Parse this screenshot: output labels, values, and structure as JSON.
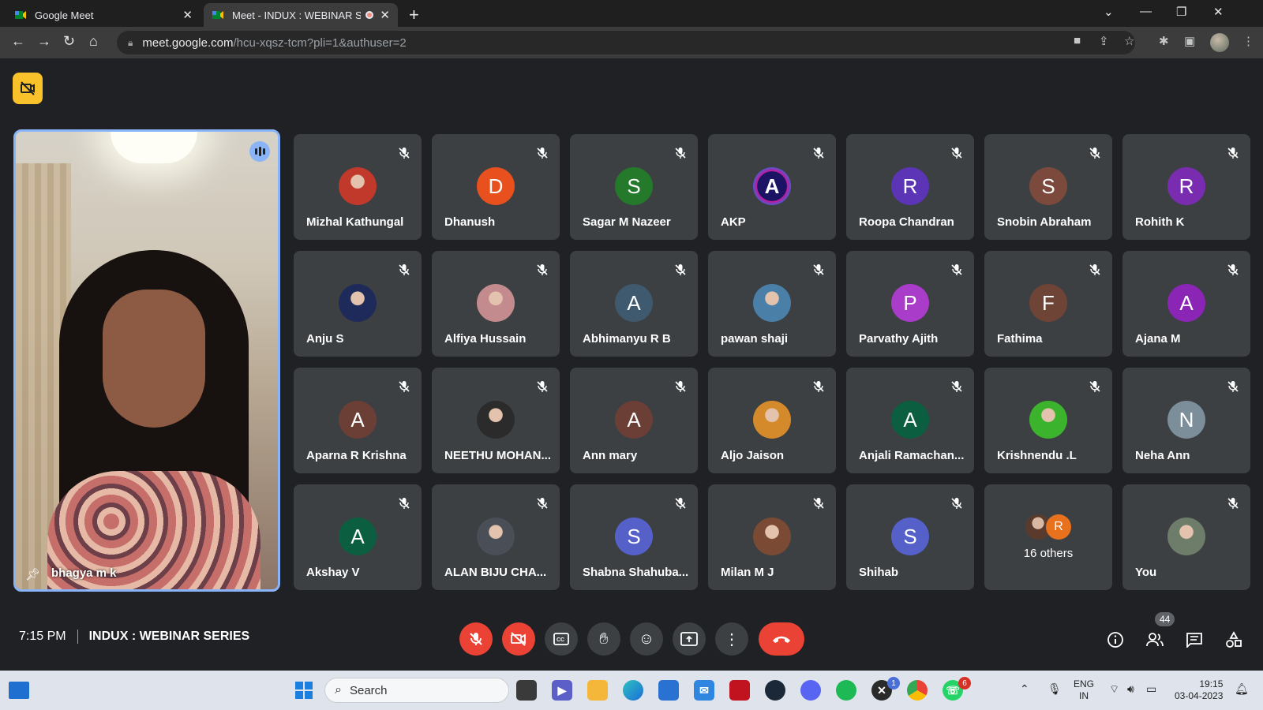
{
  "browser": {
    "tabs": [
      {
        "title": "Google Meet",
        "active": false
      },
      {
        "title": "Meet - INDUX : WEBINAR SE",
        "active": true,
        "recording": true
      }
    ],
    "url_host": "meet.google.com",
    "url_path": "/hcu-xqsz-tcm?pli=1&authuser=2"
  },
  "presenter": {
    "name": "bhagya m k",
    "speaking": true,
    "pinned": true
  },
  "participants": [
    {
      "name": "Mizhal Kathungal",
      "avatar": "photo",
      "initial": "",
      "color": "#c0392b"
    },
    {
      "name": "Dhanush",
      "avatar": "letter",
      "initial": "D",
      "color": "#e8501d"
    },
    {
      "name": "Sagar M Nazeer",
      "avatar": "letter",
      "initial": "S",
      "color": "#247a2a"
    },
    {
      "name": "AKP",
      "avatar": "logo",
      "initial": "A",
      "color": "#1b1464"
    },
    {
      "name": "Roopa Chandran",
      "avatar": "letter",
      "initial": "R",
      "color": "#5b35b5"
    },
    {
      "name": "Snobin Abraham",
      "avatar": "letter",
      "initial": "S",
      "color": "#7b4a3c"
    },
    {
      "name": "Rohith K",
      "avatar": "letter",
      "initial": "R",
      "color": "#7a2cb0"
    },
    {
      "name": "Anju S",
      "avatar": "photo",
      "initial": "",
      "color": "#1e2a5a"
    },
    {
      "name": "Alfiya Hussain",
      "avatar": "photo",
      "initial": "",
      "color": "#c48b8f"
    },
    {
      "name": "Abhimanyu R B",
      "avatar": "letter",
      "initial": "A",
      "color": "#3f5a6e"
    },
    {
      "name": "pawan shaji",
      "avatar": "photo",
      "initial": "",
      "color": "#4a7fa8"
    },
    {
      "name": "Parvathy Ajith",
      "avatar": "letter",
      "initial": "P",
      "color": "#a93cc8"
    },
    {
      "name": "Fathima",
      "avatar": "letter",
      "initial": "F",
      "color": "#6e4437"
    },
    {
      "name": "Ajana M",
      "avatar": "letter",
      "initial": "A",
      "color": "#8a25b5"
    },
    {
      "name": "Aparna R Krishna",
      "avatar": "letter",
      "initial": "A",
      "color": "#6b3e36"
    },
    {
      "name": "NEETHU MOHAN...",
      "avatar": "photo",
      "initial": "",
      "color": "#2b2b2b"
    },
    {
      "name": "Ann mary",
      "avatar": "letter",
      "initial": "A",
      "color": "#6b3e36"
    },
    {
      "name": "Aljo Jaison",
      "avatar": "photo",
      "initial": "",
      "color": "#d48a2a"
    },
    {
      "name": "Anjali Ramachan...",
      "avatar": "letter",
      "initial": "A",
      "color": "#0b5e3f"
    },
    {
      "name": "Krishnendu .L",
      "avatar": "photo",
      "initial": "",
      "color": "#3cb32c"
    },
    {
      "name": "Neha Ann",
      "avatar": "letter",
      "initial": "N",
      "color": "#7b8e99"
    },
    {
      "name": "Akshay V",
      "avatar": "letter",
      "initial": "A",
      "color": "#0b5e3f"
    },
    {
      "name": "ALAN BIJU CHA...",
      "avatar": "photo",
      "initial": "",
      "color": "#4a4f57"
    },
    {
      "name": "Shabna Shahuba...",
      "avatar": "letter",
      "initial": "S",
      "color": "#5560c8"
    },
    {
      "name": "Milan M J",
      "avatar": "photo",
      "initial": "",
      "color": "#7a4a35"
    },
    {
      "name": "Shihab",
      "avatar": "letter",
      "initial": "S",
      "color": "#5560c8"
    },
    {
      "name": "16 others",
      "avatar": "others",
      "initial": "R",
      "color": "#e8711d"
    },
    {
      "name": "You",
      "avatar": "photo",
      "initial": "",
      "color": "#6d7d6a"
    }
  ],
  "meeting": {
    "time": "7:15 PM",
    "title": "INDUX : WEBINAR SERIES",
    "participant_count": "44"
  },
  "taskbar": {
    "search_placeholder": "Search",
    "lang_top": "ENG",
    "lang_bottom": "IN",
    "clock_time": "19:15",
    "clock_date": "03-04-2023",
    "discord_badge": "1",
    "whatsapp_badge": "6"
  }
}
